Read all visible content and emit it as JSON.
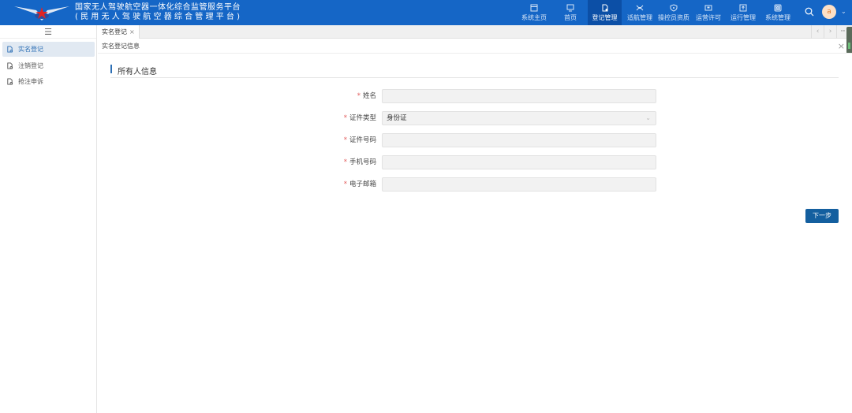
{
  "header": {
    "title_line1": "国家无人驾驶航空器一体化综合监管服务平台",
    "title_line2": "(民用无人驾驶航空器综合管理平台)",
    "nav": [
      {
        "label": "系统主页",
        "icon": "window-icon"
      },
      {
        "label": "首页",
        "icon": "monitor-icon"
      },
      {
        "label": "登记管理",
        "icon": "document-icon",
        "active": true
      },
      {
        "label": "适航管理",
        "icon": "drone-icon"
      },
      {
        "label": "操控员资质",
        "icon": "shield-icon"
      },
      {
        "label": "运营许可",
        "icon": "license-icon"
      },
      {
        "label": "运行管理",
        "icon": "upload-icon"
      },
      {
        "label": "系统管理",
        "icon": "settings-grid-icon"
      }
    ],
    "user_initial": "a"
  },
  "sidebar": {
    "items": [
      {
        "label": "实名登记",
        "active": true
      },
      {
        "label": "注销登记"
      },
      {
        "label": "抢注申诉"
      }
    ]
  },
  "tabs": [
    {
      "label": "实名登记",
      "close": "×"
    }
  ],
  "breadcrumb": "实名登记信息",
  "section_title": "所有人信息",
  "form": {
    "fields": [
      {
        "label": "姓名",
        "value": ""
      },
      {
        "label": "证件类型",
        "value": "身份证"
      },
      {
        "label": "证件号码",
        "value": ""
      },
      {
        "label": "手机号码",
        "value": ""
      },
      {
        "label": "电子邮箱",
        "value": ""
      }
    ],
    "required_mark": "*",
    "next_button": "下一步"
  }
}
